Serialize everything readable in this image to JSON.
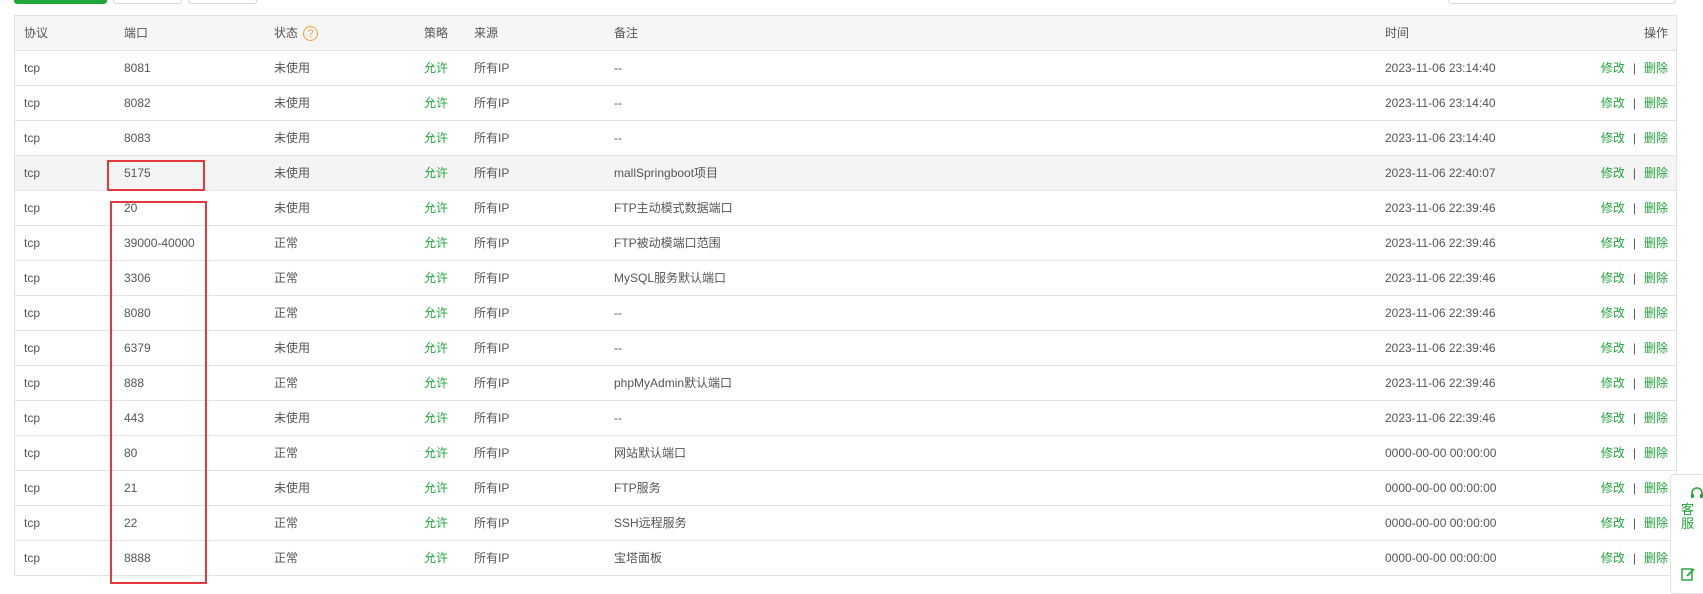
{
  "columns": {
    "protocol": "协议",
    "port": "端口",
    "status": "状态",
    "status_help": "?",
    "policy": "策略",
    "source": "来源",
    "remark": "备注",
    "time": "时间",
    "operations": "操作"
  },
  "rows": [
    {
      "protocol": "tcp",
      "port": "8081",
      "status": "未使用",
      "policy": "允许",
      "source": "所有IP",
      "remark": "--",
      "time": "2023-11-06 23:14:40",
      "edit": "修改",
      "delete": "删除"
    },
    {
      "protocol": "tcp",
      "port": "8082",
      "status": "未使用",
      "policy": "允许",
      "source": "所有IP",
      "remark": "--",
      "time": "2023-11-06 23:14:40",
      "edit": "修改",
      "delete": "删除"
    },
    {
      "protocol": "tcp",
      "port": "8083",
      "status": "未使用",
      "policy": "允许",
      "source": "所有IP",
      "remark": "--",
      "time": "2023-11-06 23:14:40",
      "edit": "修改",
      "delete": "删除"
    },
    {
      "protocol": "tcp",
      "port": "5175",
      "status": "未使用",
      "policy": "允许",
      "source": "所有IP",
      "remark": "mallSpringboot项目",
      "time": "2023-11-06 22:40:07",
      "edit": "修改",
      "delete": "删除"
    },
    {
      "protocol": "tcp",
      "port": "20",
      "status": "未使用",
      "policy": "允许",
      "source": "所有IP",
      "remark": "FTP主动模式数据端口",
      "time": "2023-11-06 22:39:46",
      "edit": "修改",
      "delete": "删除"
    },
    {
      "protocol": "tcp",
      "port": "39000-40000",
      "status": "正常",
      "policy": "允许",
      "source": "所有IP",
      "remark": "FTP被动模端口范围",
      "time": "2023-11-06 22:39:46",
      "edit": "修改",
      "delete": "删除"
    },
    {
      "protocol": "tcp",
      "port": "3306",
      "status": "正常",
      "policy": "允许",
      "source": "所有IP",
      "remark": "MySQL服务默认端口",
      "time": "2023-11-06 22:39:46",
      "edit": "修改",
      "delete": "删除"
    },
    {
      "protocol": "tcp",
      "port": "8080",
      "status": "正常",
      "policy": "允许",
      "source": "所有IP",
      "remark": "--",
      "time": "2023-11-06 22:39:46",
      "edit": "修改",
      "delete": "删除"
    },
    {
      "protocol": "tcp",
      "port": "6379",
      "status": "未使用",
      "policy": "允许",
      "source": "所有IP",
      "remark": "--",
      "time": "2023-11-06 22:39:46",
      "edit": "修改",
      "delete": "删除"
    },
    {
      "protocol": "tcp",
      "port": "888",
      "status": "正常",
      "policy": "允许",
      "source": "所有IP",
      "remark": "phpMyAdmin默认端口",
      "time": "2023-11-06 22:39:46",
      "edit": "修改",
      "delete": "删除"
    },
    {
      "protocol": "tcp",
      "port": "443",
      "status": "未使用",
      "policy": "允许",
      "source": "所有IP",
      "remark": "--",
      "time": "2023-11-06 22:39:46",
      "edit": "修改",
      "delete": "删除"
    },
    {
      "protocol": "tcp",
      "port": "80",
      "status": "正常",
      "policy": "允许",
      "source": "所有IP",
      "remark": "网站默认端口",
      "time": "0000-00-00 00:00:00",
      "edit": "修改",
      "delete": "删除"
    },
    {
      "protocol": "tcp",
      "port": "21",
      "status": "未使用",
      "policy": "允许",
      "source": "所有IP",
      "remark": "FTP服务",
      "time": "0000-00-00 00:00:00",
      "edit": "修改",
      "delete": "删除"
    },
    {
      "protocol": "tcp",
      "port": "22",
      "status": "正常",
      "policy": "允许",
      "source": "所有IP",
      "remark": "SSH远程服务",
      "time": "0000-00-00 00:00:00",
      "edit": "修改",
      "delete": "删除"
    },
    {
      "protocol": "tcp",
      "port": "8888",
      "status": "正常",
      "policy": "允许",
      "source": "所有IP",
      "remark": "宝塔面板",
      "time": "0000-00-00 00:00:00",
      "edit": "修改",
      "delete": "删除"
    }
  ],
  "side_panel": {
    "service_label": "客服",
    "service_icon": "headset-icon",
    "feedback_icon": "edit-icon"
  },
  "colors": {
    "accent": "#20a53a",
    "help_icon": "#f0a03c",
    "annotation": "#e5383b"
  }
}
